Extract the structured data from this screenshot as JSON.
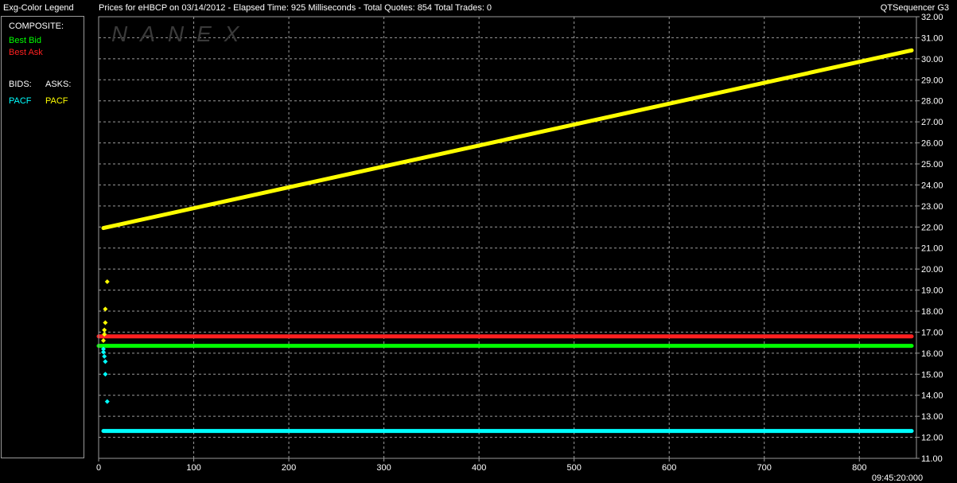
{
  "header": {
    "legend_title": "Exg-Color Legend",
    "chart_title": "Prices for  eHBCP  on  03/14/2012  -  Elapsed Time: 925 Milliseconds  -  Total Quotes: 854  Total Trades: 0",
    "app_name": "QTSequencer G3"
  },
  "legend": {
    "composite_label": "COMPOSITE:",
    "best_bid": {
      "label": "Best Bid",
      "color": "#00ff00"
    },
    "best_ask": {
      "label": "Best Ask",
      "color": "#ff2020"
    },
    "bids_label": "BIDS:",
    "asks_label": "ASKS:",
    "bid_exchange": {
      "label": "PACF",
      "color": "#00ffff"
    },
    "ask_exchange": {
      "label": "PACF",
      "color": "#ffff00"
    }
  },
  "watermark": {
    "text": "NANEX",
    "color": "#3a3a3a"
  },
  "colors": {
    "background": "#000000",
    "grid": "#cfcfcf",
    "frame": "#9a9a9a"
  },
  "chart_data": {
    "type": "line",
    "title": "Prices for  eHBCP  on  03/14/2012  -  Elapsed Time: 925 Milliseconds  -  Total Quotes: 854  Total Trades: 0",
    "xlabel": "",
    "ylabel": "",
    "xlim": [
      0,
      860
    ],
    "ylim": [
      11.0,
      32.0
    ],
    "x_ticks": [
      0,
      100,
      200,
      300,
      400,
      500,
      600,
      700,
      800
    ],
    "x_tick_labels": [
      "0",
      "100",
      "200",
      "300",
      "400",
      "500",
      "600",
      "700",
      "800"
    ],
    "x_end_label": "09:45:20:000",
    "y_ticks": [
      11.0,
      12.0,
      13.0,
      14.0,
      15.0,
      16.0,
      17.0,
      18.0,
      19.0,
      20.0,
      21.0,
      22.0,
      23.0,
      24.0,
      25.0,
      26.0,
      27.0,
      28.0,
      29.0,
      30.0,
      31.0,
      32.0
    ],
    "y_tick_labels": [
      "11.00",
      "12.00",
      "13.00",
      "14.00",
      "15.00",
      "16.00",
      "17.00",
      "18.00",
      "19.00",
      "20.00",
      "21.00",
      "22.00",
      "23.00",
      "24.00",
      "25.00",
      "26.00",
      "27.00",
      "28.00",
      "29.00",
      "30.00",
      "31.00",
      "32.00"
    ],
    "grid": true,
    "series": [
      {
        "name": "Best Ask",
        "color": "#ff2020",
        "kind": "line",
        "x": [
          0,
          855
        ],
        "y": [
          16.8,
          16.8
        ]
      },
      {
        "name": "Best Bid",
        "color": "#00ff00",
        "kind": "line",
        "x": [
          0,
          855
        ],
        "y": [
          16.35,
          16.35
        ]
      },
      {
        "name": "PACF",
        "color": "#ffff00",
        "kind": "line",
        "x": [
          5,
          855
        ],
        "y": [
          21.95,
          30.4
        ]
      },
      {
        "name": "PACF",
        "color": "#00ffff",
        "kind": "line",
        "x": [
          5,
          855
        ],
        "y": [
          12.3,
          12.3
        ]
      },
      {
        "name": "PACF",
        "color": "#ffff00",
        "kind": "points",
        "x": [
          4,
          2,
          2,
          1,
          1,
          0
        ],
        "y": [
          19.4,
          18.1,
          17.45,
          17.1,
          16.9,
          16.6
        ]
      },
      {
        "name": "PACF",
        "color": "#00ffff",
        "kind": "points",
        "x": [
          0,
          0,
          1,
          2,
          2,
          4
        ],
        "y": [
          16.2,
          16.05,
          15.85,
          15.6,
          15.0,
          13.7
        ]
      }
    ]
  }
}
